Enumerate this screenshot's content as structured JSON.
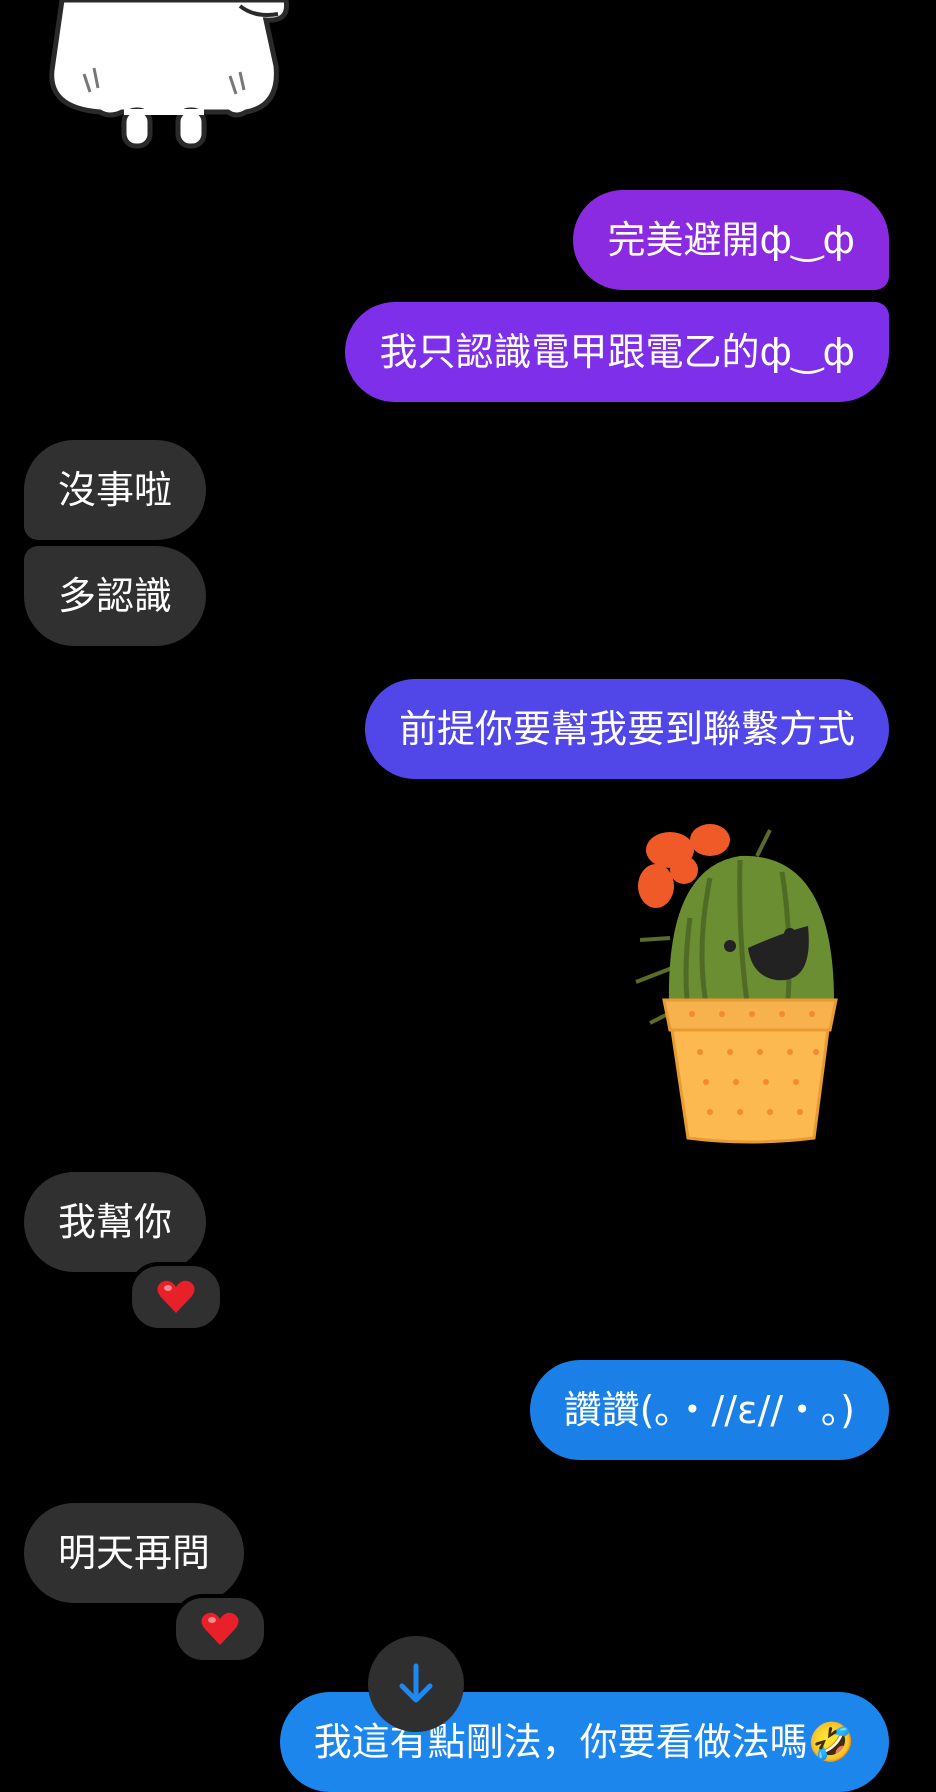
{
  "colors": {
    "background": "#000000",
    "received_bubble": "#303030",
    "sent_purple_1": "#8a2be2",
    "sent_purple_2": "#7d2fea",
    "sent_indigo": "#5147e8",
    "sent_blue": "#1a7fe6",
    "sent_blue_2": "#1c86ec",
    "scroll_arrow": "#1e88f0"
  },
  "messages": [
    {
      "side": "sent",
      "text": "完美避開ф‿ф"
    },
    {
      "side": "sent",
      "text": "我只認識電甲跟電乙的ф‿ф"
    },
    {
      "side": "received",
      "text": "沒事啦"
    },
    {
      "side": "received",
      "text": "多認識"
    },
    {
      "side": "sent",
      "text": "前提你要幫我要到聯繫方式"
    },
    {
      "side": "sent",
      "sticker": "cactus-sticker"
    },
    {
      "side": "received",
      "text": "我幫你",
      "reaction": "heart-icon"
    },
    {
      "side": "sent",
      "text": "讚讚(｡・//ε//・｡)"
    },
    {
      "side": "received",
      "text": "明天再問",
      "reaction": "heart-icon"
    },
    {
      "side": "sent",
      "text": "我這有點剛法，你要看做法嗎🤣"
    }
  ],
  "scroll_button_icon": "arrow-down-icon"
}
